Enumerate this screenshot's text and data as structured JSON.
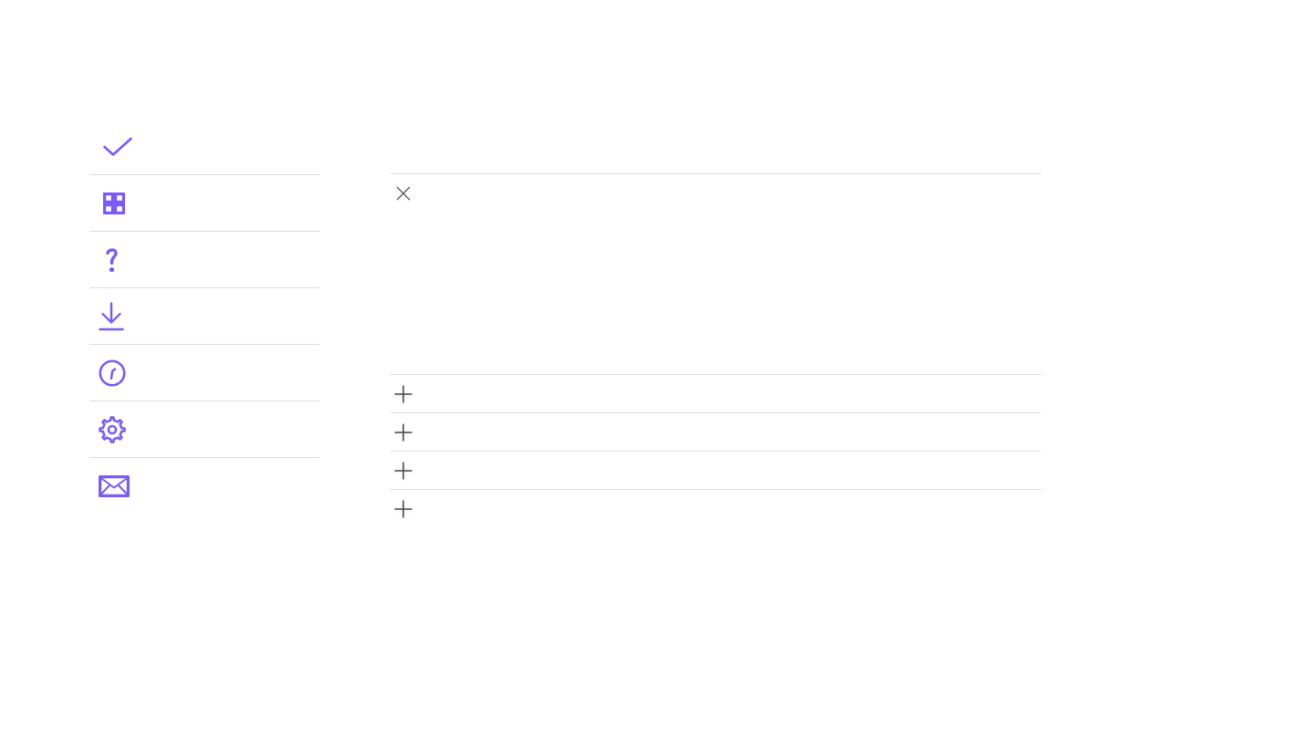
{
  "sidebar": {
    "items": [
      {
        "kind": "check"
      },
      {
        "kind": "grid"
      },
      {
        "kind": "help"
      },
      {
        "kind": "download"
      },
      {
        "kind": "clock"
      },
      {
        "kind": "settings"
      },
      {
        "kind": "mail"
      }
    ]
  },
  "accordion": {
    "items": [
      {
        "expanded": true
      },
      {
        "expanded": false
      },
      {
        "expanded": false
      },
      {
        "expanded": false
      },
      {
        "expanded": false
      }
    ]
  }
}
